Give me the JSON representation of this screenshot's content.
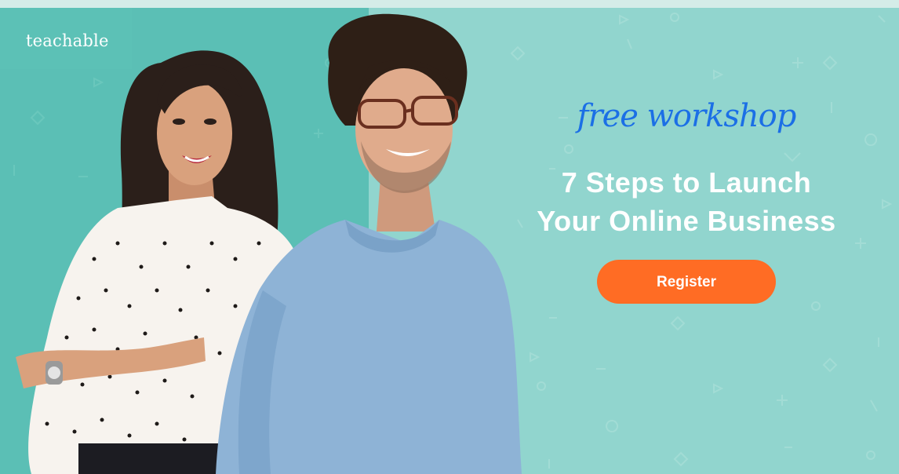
{
  "brand": {
    "logo_text": "teachable"
  },
  "hero": {
    "eyebrow": "free workshop",
    "headline_line1": "7 Steps to Launch",
    "headline_line2": "Your Online Business",
    "cta_label": "Register"
  },
  "colors": {
    "background": "#91d5ce",
    "left_panel": "#5bbfb5",
    "eyebrow": "#1b6fe6",
    "headline": "#ffffff",
    "cta_background": "#ff6c24",
    "cta_text": "#ffffff"
  },
  "photo": {
    "subjects": [
      "woman-in-polka-dot-blouse",
      "man-in-blue-sweater-with-glasses"
    ]
  }
}
